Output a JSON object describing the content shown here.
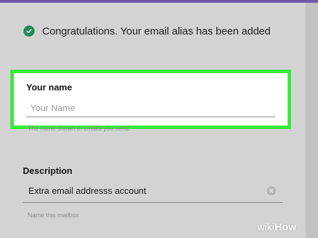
{
  "notification": {
    "text": "Congratulations. Your email alias has been added",
    "icon": "check-circle-icon"
  },
  "name_section": {
    "label": "Your name",
    "placeholder": "Your Name",
    "value": "",
    "hint": "The name shown in emails you send."
  },
  "description_section": {
    "label": "Description",
    "value": "Extra email addresss account",
    "hint": "Name this mailbox."
  },
  "watermark": {
    "prefix": "wiki",
    "suffix": "How"
  },
  "colors": {
    "highlight": "#38e83a",
    "success": "#1f8a5a",
    "top_bar": "#6e56a8"
  }
}
